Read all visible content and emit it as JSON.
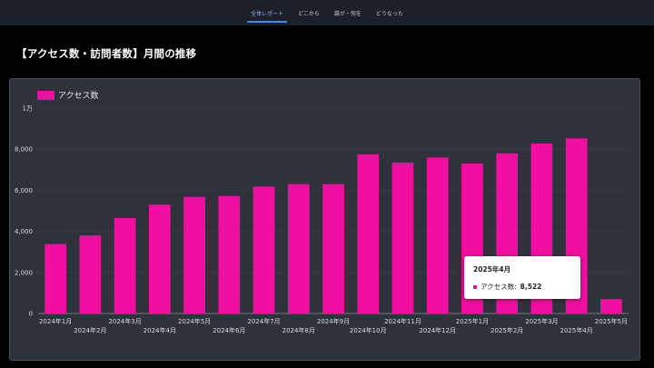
{
  "nav": {
    "tabs": [
      {
        "label": "全体レポート",
        "active": true
      },
      {
        "label": "どこから",
        "active": false
      },
      {
        "label": "誰が・何を",
        "active": false
      },
      {
        "label": "どうなった",
        "active": false
      }
    ]
  },
  "page": {
    "title": "【アクセス数・訪問者数】月間の推移"
  },
  "legend": {
    "label": "アクセス数"
  },
  "tooltip": {
    "title": "2025年4月",
    "label": "アクセス数:",
    "value": "8,522"
  },
  "colors": {
    "bar": "#f00fa0",
    "grid": "#3a404a",
    "card": "#2d323b"
  },
  "chart_data": {
    "type": "bar",
    "categories": [
      "2024年1月",
      "2024年2月",
      "2024年3月",
      "2024年4月",
      "2024年5月",
      "2024年6月",
      "2024年7月",
      "2024年8月",
      "2024年9月",
      "2024年10月",
      "2024年11月",
      "2024年12月",
      "2025年1月",
      "2025年2月",
      "2025年3月",
      "2025年4月",
      "2025年5月"
    ],
    "series": [
      {
        "name": "アクセス数",
        "values": [
          3380,
          3800,
          4650,
          5300,
          5680,
          5720,
          6180,
          6300,
          6300,
          7750,
          7350,
          7600,
          7300,
          7800,
          8280,
          8522,
          700
        ]
      }
    ],
    "yticks": [
      0,
      2000,
      4000,
      6000,
      8000,
      10000
    ],
    "ytick_labels": [
      "0",
      "2,000",
      "4,000",
      "6,000",
      "8,000",
      "1万"
    ],
    "ylim": [
      0,
      10000
    ],
    "legend_position": "top-left",
    "grid": true
  }
}
